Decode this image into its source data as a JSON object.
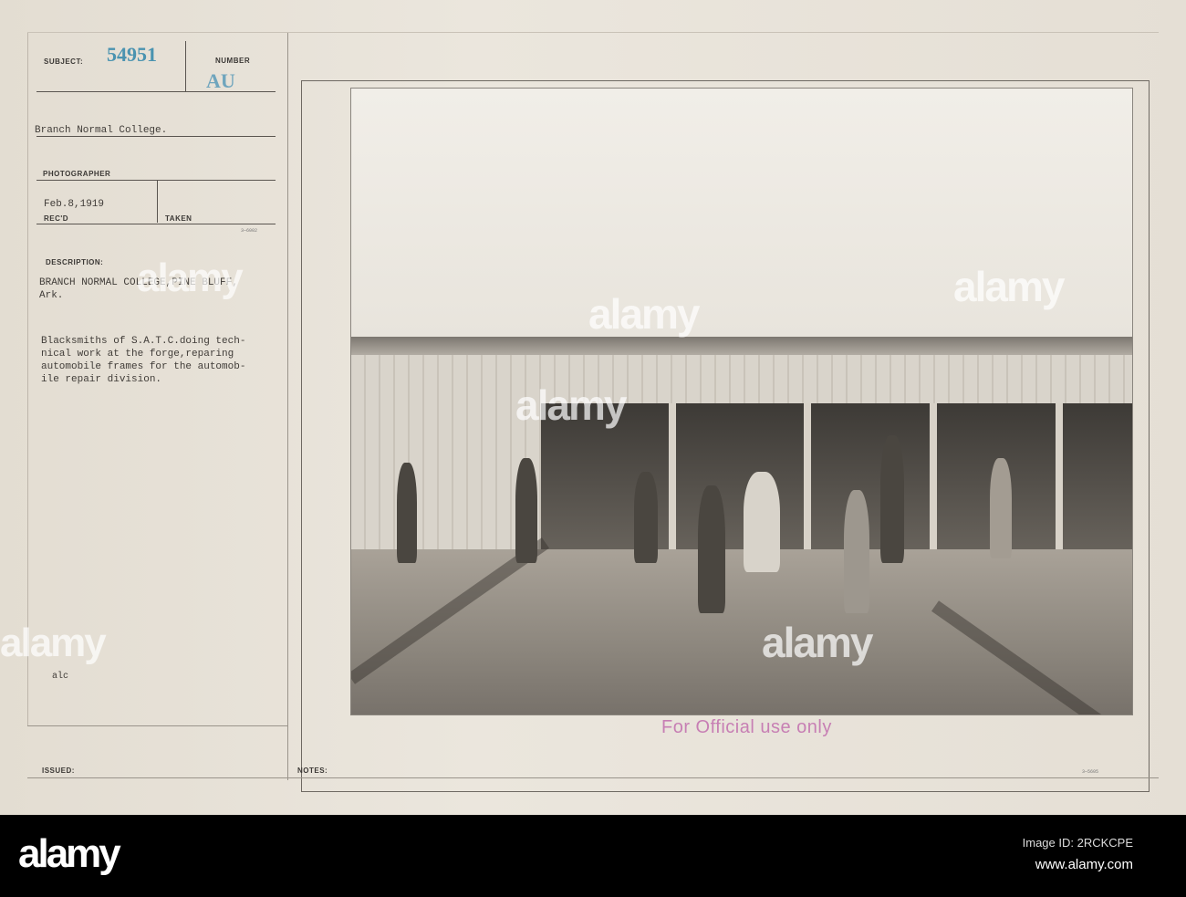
{
  "card": {
    "subject_label": "SUBJECT:",
    "subject_number": "54951",
    "number_label": "NUMBER",
    "number_value": "AU",
    "subject_text": "Branch Normal College.",
    "photographer_label": "PHOTOGRAPHER",
    "recd_date": "Feb.8,1919",
    "recd_label": "REC'D",
    "taken_label": "TAKEN",
    "form_code_top": "3—6002",
    "description_label": "DESCRIPTION:",
    "description_place": [
      "BRANCH NORMAL COLLEGE,PINE BLUFF,",
      "Ark."
    ],
    "description_text": [
      "Blacksmiths of S.A.T.C.doing tech-",
      "nical work at the forge,reparing",
      "automobile frames for the automob-",
      "ile repair division."
    ],
    "initials": "alc",
    "issued_label": "ISSUED:",
    "notes_label": "NOTES:",
    "form_code_bottom": "3—5605",
    "stamp": "For Official use only",
    "stamp_color": "#c77fb4",
    "number_color": "#4a93b0"
  },
  "watermark": {
    "logo": "alamy",
    "image_id": "Image ID: 2RCKCPE",
    "url": "www.alamy.com"
  }
}
